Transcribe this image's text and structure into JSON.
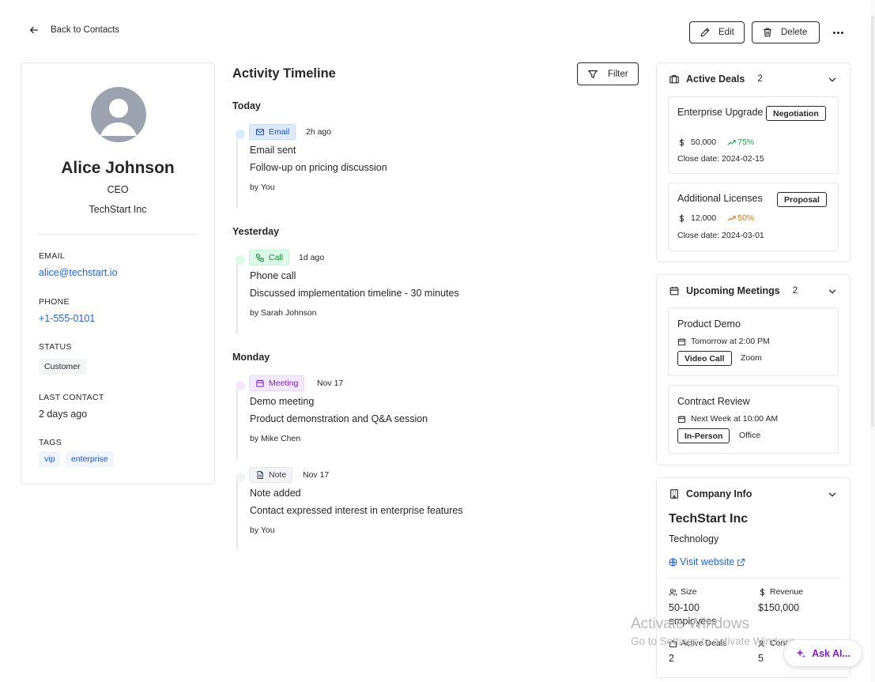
{
  "header": {
    "back_label": "Back to Contacts",
    "edit_label": "Edit",
    "delete_label": "Delete"
  },
  "contact": {
    "name": "Alice Johnson",
    "title": "CEO",
    "company": "TechStart Inc",
    "fields": {
      "email_label": "EMAIL",
      "email": "alice@techstart.io",
      "phone_label": "PHONE",
      "phone": "+1-555-0101",
      "status_label": "STATUS",
      "status": "Customer",
      "last_contact_label": "LAST CONTACT",
      "last_contact": "2 days ago",
      "tags_label": "TAGS",
      "tags": [
        "vip",
        "enterprise"
      ]
    }
  },
  "timeline": {
    "title": "Activity Timeline",
    "filter_label": "Filter",
    "groups": [
      {
        "day": "Today",
        "events": [
          {
            "type": "Email",
            "time": "2h ago",
            "title": "Email sent",
            "desc": "Follow-up on pricing discussion",
            "by": "by You",
            "icon": "mail-icon"
          }
        ]
      },
      {
        "day": "Yesterday",
        "events": [
          {
            "type": "Call",
            "time": "1d ago",
            "title": "Phone call",
            "desc": "Discussed implementation timeline - 30 minutes",
            "by": "by Sarah Johnson",
            "icon": "phone-icon"
          }
        ]
      },
      {
        "day": "Monday",
        "events": [
          {
            "type": "Meeting",
            "time": "Nov 17",
            "title": "Demo meeting",
            "desc": "Product demonstration and Q&A session",
            "by": "by Mike Chen",
            "icon": "calendar-icon"
          },
          {
            "type": "Note",
            "time": "Nov 17",
            "title": "Note added",
            "desc": "Contact expressed interest in enterprise features",
            "by": "by You",
            "icon": "document-icon"
          }
        ]
      }
    ]
  },
  "deals": {
    "title": "Active Deals",
    "count": "2",
    "items": [
      {
        "name": "Enterprise Upgrade",
        "stage": "Negotiation",
        "amount": "50,000",
        "probability": "75%",
        "close": "Close date: 2024-02-15"
      },
      {
        "name": "Additional Licenses",
        "stage": "Proposal",
        "amount": "12,000",
        "probability": "50%",
        "close": "Close date: 2024-03-01"
      }
    ]
  },
  "meetings": {
    "title": "Upcoming Meetings",
    "count": "2",
    "items": [
      {
        "name": "Product Demo",
        "when": "Tomorrow at 2:00 PM",
        "kind": "Video Call",
        "where": "Zoom"
      },
      {
        "name": "Contract Review",
        "when": "Next Week at 10:00 AM",
        "kind": "In-Person",
        "where": "Office"
      }
    ]
  },
  "company": {
    "title": "Company Info",
    "name": "TechStart Inc",
    "industry": "Technology",
    "website_label": "Visit website",
    "size_label": "Size",
    "size": "50-100 employees",
    "revenue_label": "Revenue",
    "revenue": "$150,000",
    "active_deals_label": "Active Deals",
    "active_deals": "2",
    "contacts_label": "Cont",
    "contacts": "5"
  },
  "overlay": {
    "watermark_title": "Activate Windows",
    "watermark_sub": "Go to Settings to activate Windows.",
    "ask_ai_label": "Ask AI..."
  },
  "colors": {
    "accent_link": "#2563eb",
    "probability_high": "#16a34a",
    "probability_mid": "#d97706",
    "ask_ai": "#7e22ce"
  }
}
